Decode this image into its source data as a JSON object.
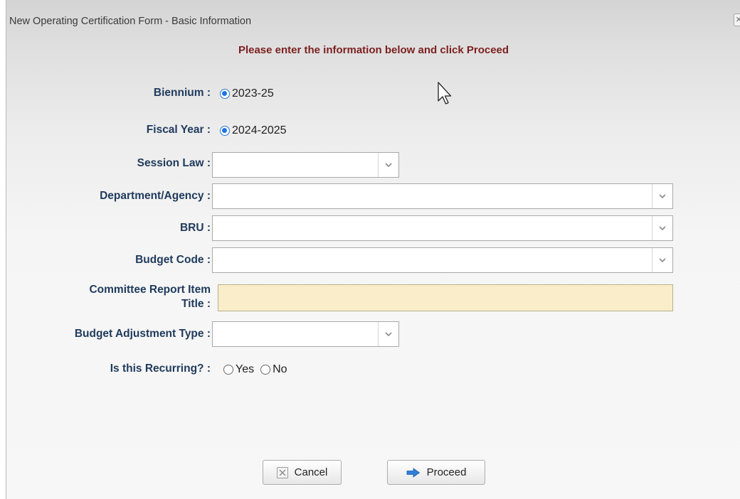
{
  "dialog": {
    "title": "New Operating Certification Form - Basic Information",
    "close_label": "×",
    "instruction": "Please enter the information below and click Proceed"
  },
  "form": {
    "biennium": {
      "label": "Biennium :",
      "option": "2023-25"
    },
    "fiscal_year": {
      "label": "Fiscal Year :",
      "option": "2024-2025"
    },
    "session_law": {
      "label": "Session Law :",
      "value": ""
    },
    "department_agency": {
      "label": "Department/Agency :",
      "value": ""
    },
    "bru": {
      "label": "BRU :",
      "value": ""
    },
    "budget_code": {
      "label": "Budget Code :",
      "value": ""
    },
    "committee_report_item_title": {
      "label_line1": "Committee Report Item",
      "label_line2": "Title :",
      "value": ""
    },
    "budget_adjustment_type": {
      "label": "Budget Adjustment Type :",
      "value": ""
    },
    "recurring": {
      "label": "Is this Recurring? :",
      "options": [
        "Yes",
        "No"
      ],
      "selected": null
    }
  },
  "buttons": {
    "cancel": "Cancel",
    "proceed": "Proceed"
  },
  "colors": {
    "instruction": "#7d1f1f",
    "label": "#1f3a5c",
    "radio_selected": "#1e74e3",
    "required_field_bg": "#faedca",
    "proceed_icon": "#2f7fd8"
  },
  "icons": {
    "close": "close-icon",
    "dropdown": "chevron-down-icon",
    "cancel": "x-box-icon",
    "proceed": "arrow-right-icon",
    "cursor": "mouse-pointer-icon"
  }
}
